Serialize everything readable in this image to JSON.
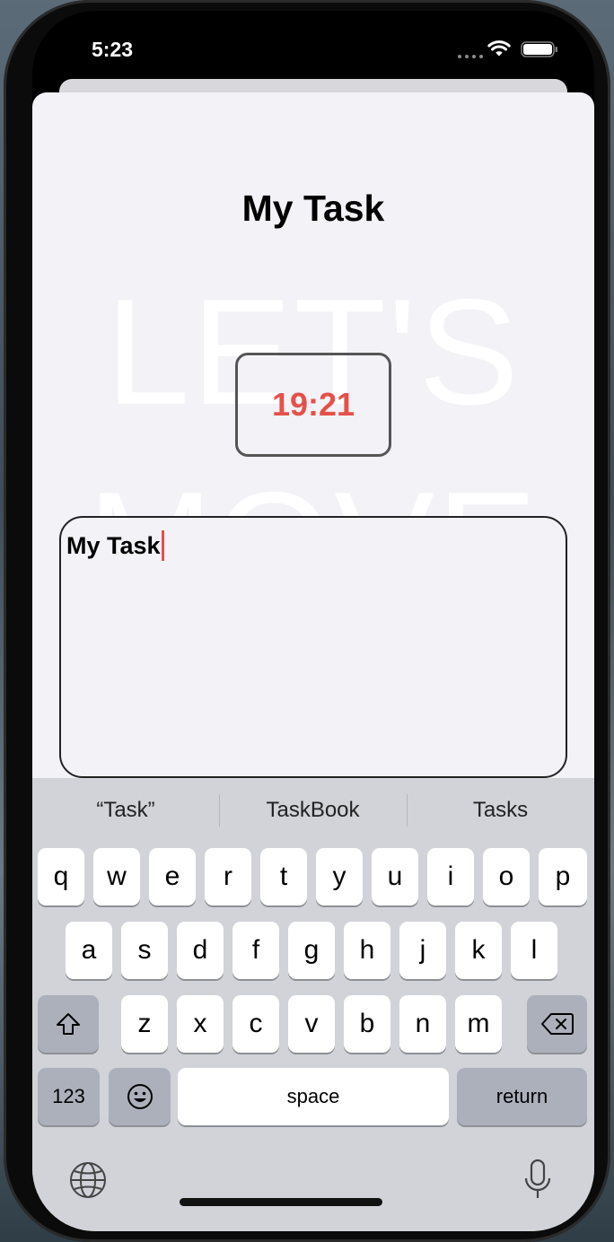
{
  "status_bar": {
    "time": "5:23"
  },
  "sheet": {
    "title": "My Task",
    "background_text_line1": "LET'S",
    "background_text_line2": "MOVE",
    "timer": "19:21",
    "task_text": "My Task"
  },
  "keyboard": {
    "suggestions": [
      "“Task”",
      "TaskBook",
      "Tasks"
    ],
    "row1": [
      "q",
      "w",
      "e",
      "r",
      "t",
      "y",
      "u",
      "i",
      "o",
      "p"
    ],
    "row2": [
      "a",
      "s",
      "d",
      "f",
      "g",
      "h",
      "j",
      "k",
      "l"
    ],
    "row3": [
      "z",
      "x",
      "c",
      "v",
      "b",
      "n",
      "m"
    ],
    "numbers_label": "123",
    "space_label": "space",
    "return_label": "return"
  },
  "colors": {
    "accent": "#e5514a",
    "sheet_bg": "#f2f2f7",
    "keyboard_bg": "#d1d3d9"
  }
}
